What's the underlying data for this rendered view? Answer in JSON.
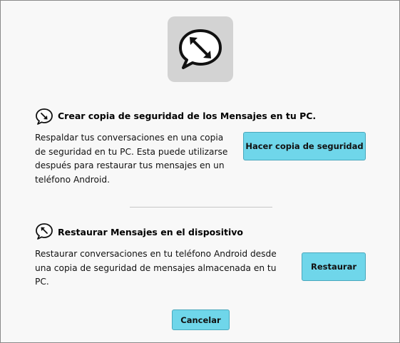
{
  "backup": {
    "title": "Crear copia de seguridad de los Mensajes en tu PC.",
    "description": "Respaldar tus conversaciones en una copia\nde seguridad en tu PC. Esta puede utilizarse\ndespués para restaurar tus mensajes en un\nteléfono Android.",
    "button_label": "Hacer copia de seguridad",
    "icon": "chat-arrow-down-right-icon"
  },
  "restore": {
    "title": "Restaurar Mensajes en el dispositivo",
    "description": "Restaurar conversaciones en tu teléfono Android desde\nuna copia de seguridad de mensajes almacenada en tu\nPC.",
    "button_label": "Restaurar",
    "icon": "chat-arrow-up-left-icon"
  },
  "footer": {
    "cancel_label": "Cancelar"
  },
  "hero_icon": "chat-sync-icon",
  "colors": {
    "button_fill": "#6fd6ea",
    "hero_background": "#d3d3d3"
  }
}
